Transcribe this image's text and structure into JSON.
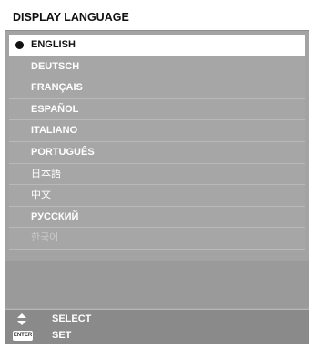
{
  "menu": {
    "title": "DISPLAY LANGUAGE",
    "languages": [
      {
        "label": "ENGLISH",
        "selected": true
      },
      {
        "label": "DEUTSCH"
      },
      {
        "label": "FRANÇAIS"
      },
      {
        "label": "ESPAÑOL"
      },
      {
        "label": "ITALIANO"
      },
      {
        "label": "PORTUGUÊS"
      },
      {
        "label": "日本語"
      },
      {
        "label": "中文"
      },
      {
        "label": "РУССКИЙ"
      },
      {
        "label": "한국어",
        "disabled": true
      }
    ]
  },
  "footer": {
    "select_label": "SELECT",
    "set_label": "SET",
    "enter_key_label": "ENTER"
  },
  "icons": {
    "selection": "filled-circle-icon",
    "navigate": "up-down-arrows-icon",
    "enter": "enter-key-icon"
  }
}
